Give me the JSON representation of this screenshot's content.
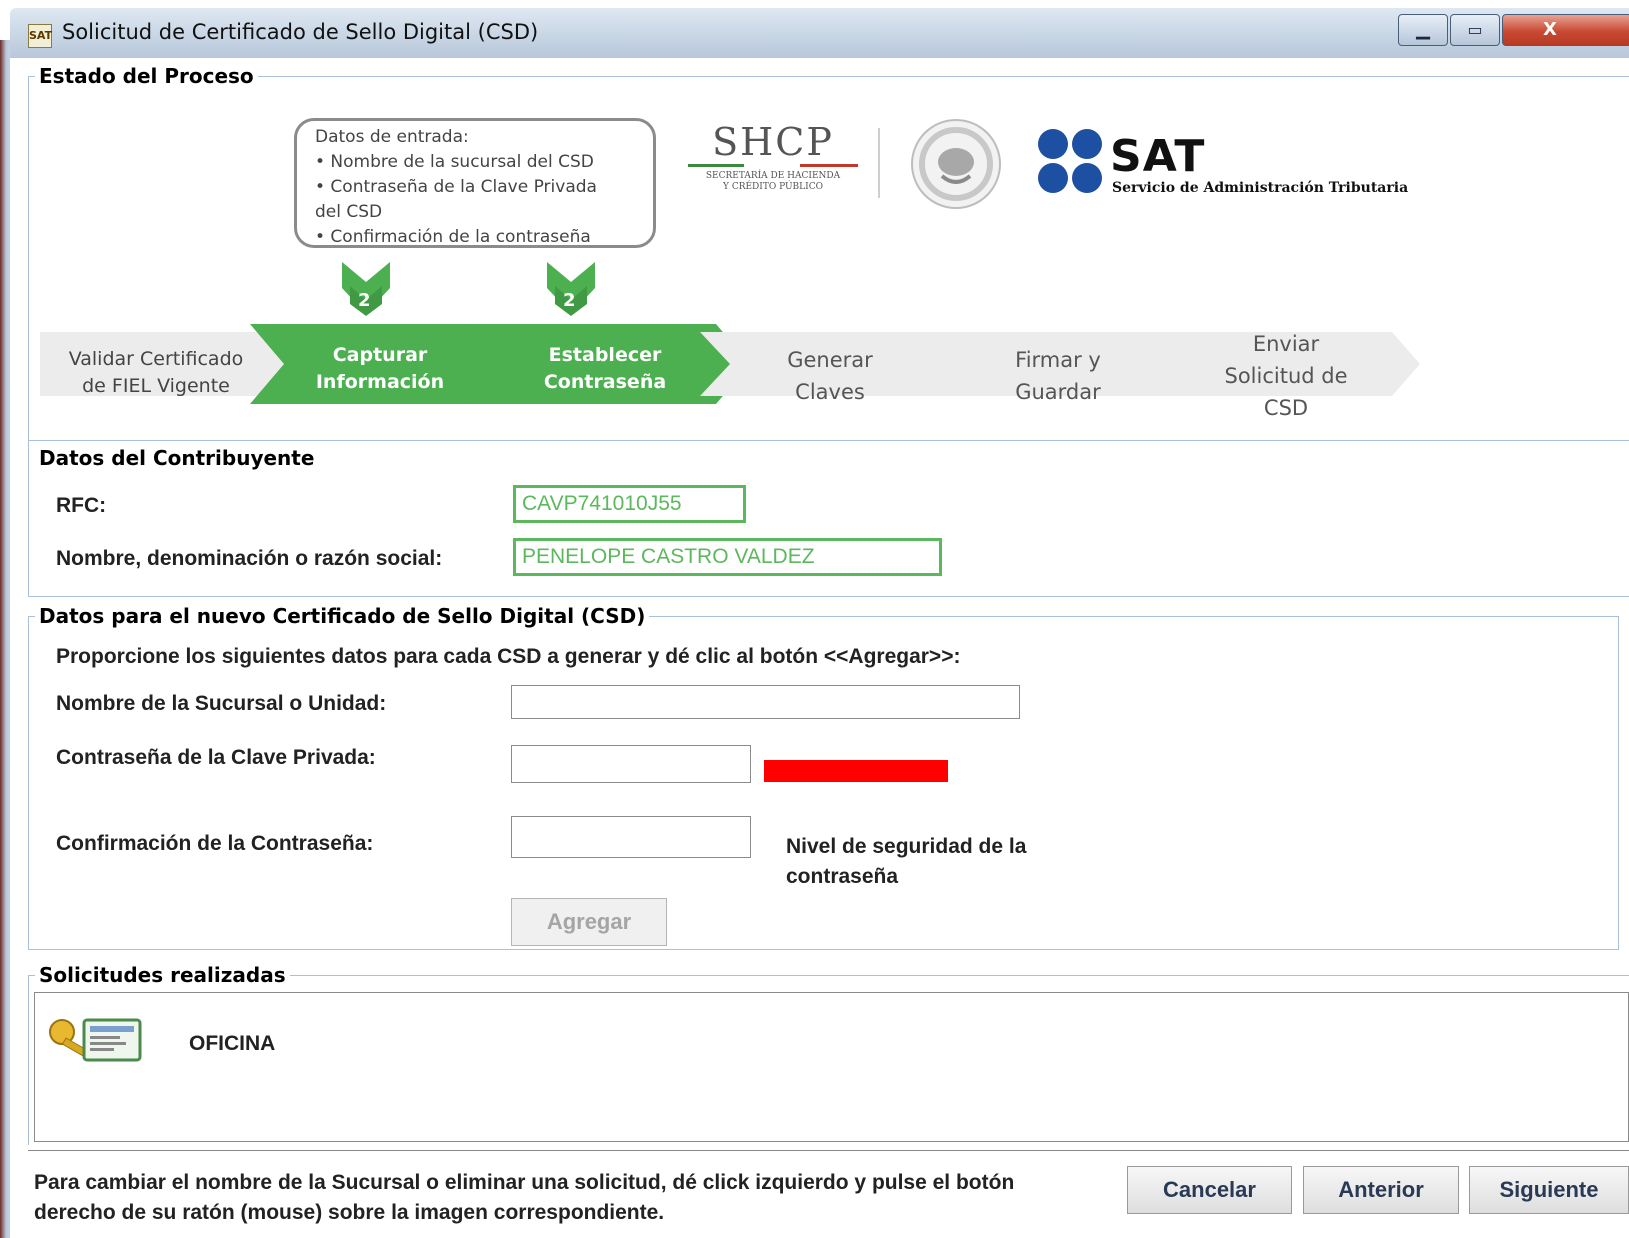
{
  "window": {
    "title": "Solicitud de Certificado de Sello Digital (CSD)",
    "app_icon_label": "SAT",
    "controls": {
      "minimize": "▁",
      "maximize": "▭",
      "close": "X"
    }
  },
  "process": {
    "section_title": "Estado del Proceso",
    "note": {
      "heading": "Datos de entrada:",
      "items": [
        "• Nombre de la sucursal del CSD",
        "• Contraseña de la Clave Privada",
        "del CSD",
        "• Confirmación de la contraseña"
      ]
    },
    "markers": [
      "2",
      "2"
    ],
    "steps": [
      {
        "line1": "Validar Certificado",
        "line2": "de FIEL Vigente",
        "state": "done"
      },
      {
        "line1": "Capturar",
        "line2": "Información",
        "state": "active"
      },
      {
        "line1": "Establecer",
        "line2": "Contraseña",
        "state": "active"
      },
      {
        "line1": "Generar",
        "line2": "Claves",
        "state": "pending"
      },
      {
        "line1": "Firmar y",
        "line2": "Guardar",
        "state": "pending"
      },
      {
        "line1": "Enviar",
        "line2": "Solicitud de",
        "line3": "CSD",
        "state": "pending"
      }
    ],
    "logos": {
      "shcp_title": "SHCP",
      "shcp_line1": "SECRETARÍA DE HACIENDA",
      "shcp_line2": "Y CRÉDITO PÚBLICO",
      "sat_title": "SAT",
      "sat_subtitle": "Servicio de Administración Tributaria"
    }
  },
  "taxpayer": {
    "section_title": "Datos del Contribuyente",
    "rfc_label": "RFC:",
    "rfc_value": "CAVP741010J55",
    "name_label": "Nombre, denominación o razón social:",
    "name_value": "PENELOPE CASTRO VALDEZ"
  },
  "csd": {
    "section_title": "Datos para el nuevo Certificado de Sello Digital (CSD)",
    "instructions": "Proporcione los siguientes datos para cada CSD a generar y dé clic al botón <<Agregar>>:",
    "branch_label": "Nombre de la Sucursal o Unidad:",
    "branch_value": "",
    "password_label": "Contraseña de la Clave Privada:",
    "password_value": "",
    "confirm_label": "Confirmación de la Contraseña:",
    "confirm_value": "",
    "strength_label_line1": "Nivel de seguridad de la",
    "strength_label_line2": "contraseña",
    "strength_color": "#ff0000",
    "add_button": "Agregar"
  },
  "requests": {
    "section_title": "Solicitudes realizadas",
    "items": [
      {
        "label": "OFICINA",
        "icon": "certificate-key-icon"
      }
    ]
  },
  "footer": {
    "hint_line1": "Para cambiar el nombre de la Sucursal o eliminar una solicitud, dé click izquierdo y pulse el botón",
    "hint_line2": "derecho de su ratón (mouse) sobre la imagen correspondiente.",
    "cancel": "Cancelar",
    "previous": "Anterior",
    "next": "Siguiente"
  },
  "colors": {
    "active_step": "#4caf50",
    "pending_step": "#ececec",
    "field_border": "#5cb85c"
  }
}
